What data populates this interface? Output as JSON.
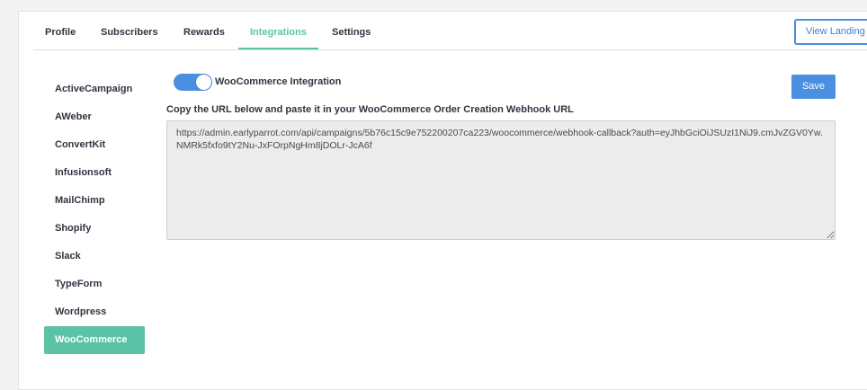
{
  "tabs": [
    {
      "label": "Profile",
      "active": false
    },
    {
      "label": "Subscribers",
      "active": false
    },
    {
      "label": "Rewards",
      "active": false
    },
    {
      "label": "Integrations",
      "active": true
    },
    {
      "label": "Settings",
      "active": false
    }
  ],
  "header": {
    "landing_label": "View Landing Page"
  },
  "sidebar": {
    "items": [
      {
        "label": "ActiveCampaign"
      },
      {
        "label": "AWeber"
      },
      {
        "label": "ConvertKit"
      },
      {
        "label": "Infusionsoft"
      },
      {
        "label": "MailChimp"
      },
      {
        "label": "Shopify"
      },
      {
        "label": "Slack"
      },
      {
        "label": "TypeForm"
      },
      {
        "label": "Wordpress"
      },
      {
        "label": "WooCommerce"
      }
    ],
    "active_index": 9
  },
  "integration": {
    "toggle_label": "WooCommerce Integration",
    "toggle_on": true,
    "save_label": "Save",
    "instruction": "Copy the URL below and paste it in your WooCommerce Order Creation Webhook URL",
    "webhook_url": "https://admin.earlyparrot.com/api/campaigns/5b76c15c9e752200207ca223/woocommerce/webhook-callback?auth=eyJhbGciOiJSUzI1NiJ9.cmJvZGV0Yw.NMRk5fxfo9tY2Nu-JxFOrpNgHm8jDOLr-JcA6f"
  },
  "colors": {
    "accent": "#5cc2a6",
    "primary": "#4a8fe0"
  }
}
